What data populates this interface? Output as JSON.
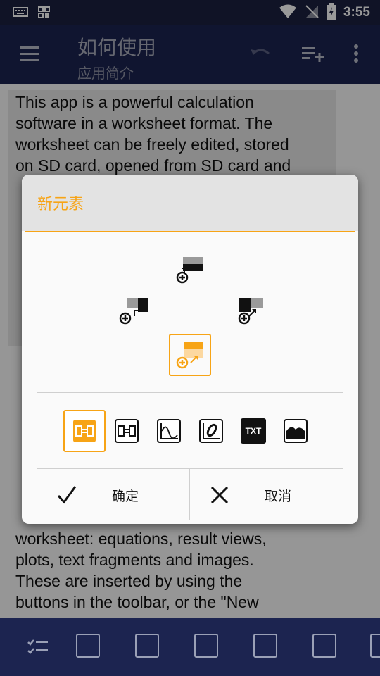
{
  "status_bar": {
    "time": "3:55"
  },
  "app_bar": {
    "title": "如何使用",
    "subtitle": "应用简介"
  },
  "content": {
    "lines_top": [
      "This app is a powerful calculation",
      "software in a worksheet format. The",
      "worksheet can be freely edited, stored",
      "on SD card, opened from SD card and"
    ],
    "lines_bottom": [
      "worksheet: equations, result views,",
      "plots, text fragments and images.",
      "These are inserted by using the",
      "buttons in the toolbar, or the \"New"
    ]
  },
  "dialog": {
    "title": "新元素",
    "type_icons": [
      "equation-icon",
      "result-view-icon",
      "plot-icon",
      "parametric-plot-icon",
      "text-icon",
      "image-icon"
    ],
    "text_icon_label": "TXT",
    "ok_label": "确定",
    "cancel_label": "取消"
  },
  "colors": {
    "accent": "#f7a416",
    "appbar": "#1c2450",
    "statusbar": "#1b2040"
  }
}
